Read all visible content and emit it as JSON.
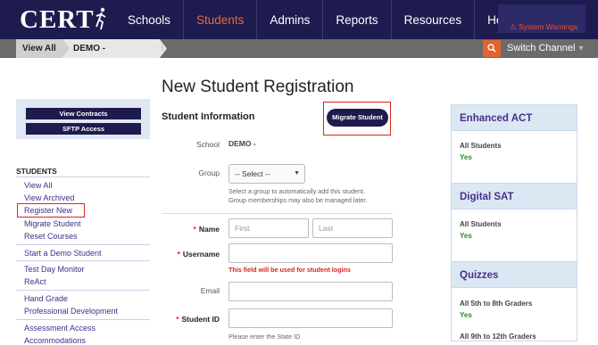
{
  "topbar": {
    "logo": "CERT",
    "nav": [
      {
        "label": "Schools",
        "active": false
      },
      {
        "label": "Students",
        "active": true
      },
      {
        "label": "Admins",
        "active": false
      },
      {
        "label": "Reports",
        "active": false
      },
      {
        "label": "Resources",
        "active": false
      },
      {
        "label": "Help",
        "active": false
      }
    ],
    "system_warnings": "System Warnings",
    "colors": {
      "bar": "#1e1b4f",
      "active": "#e66a3e",
      "warning": "#e55230"
    }
  },
  "subbar": {
    "breadcrumb": [
      "View All",
      "DEMO -"
    ],
    "breadcrumb_sep": "⁝",
    "switch_channel": "Switch Channel",
    "search_icon": "search-icon"
  },
  "page": {
    "title": "New Student Registration"
  },
  "sidebar": {
    "buttons": [
      "View Contracts",
      "SFTP Access"
    ],
    "heading": "STUDENTS",
    "groups": [
      [
        "View All",
        "View Archived",
        "Register New",
        "Migrate Student",
        "Reset Courses"
      ],
      [
        "Start a Demo Student"
      ],
      [
        "Test Day Monitor",
        "ReAct"
      ],
      [
        "Hand Grade",
        "Professional Development"
      ],
      [
        "Assessment Access",
        "Accommodations"
      ]
    ]
  },
  "form": {
    "section_title": "Student Information",
    "migrate_button": "Migrate Student",
    "school_label": "School",
    "school_value": "DEMO -",
    "group_label": "Group",
    "group_selected": "-- Select --",
    "group_help_1": "Select a group to automatically add this student.",
    "group_help_2": "Group memberships may also be managed later.",
    "name_label": "Name",
    "first_placeholder": "First",
    "last_placeholder": "Last",
    "username_label": "Username",
    "username_note": "This field will be used for student logins",
    "email_label": "Email",
    "student_id_label": "Student ID",
    "student_id_note": "Please enter the State ID",
    "required_mark": "*"
  },
  "right_panels": [
    {
      "title": "Enhanced ACT",
      "items": [
        {
          "label": "All Students",
          "value": "Yes"
        }
      ]
    },
    {
      "title": "Digital SAT",
      "items": [
        {
          "label": "All Students",
          "value": "Yes"
        }
      ]
    },
    {
      "title": "Quizzes",
      "items": [
        {
          "label": "All 5th to 8th Graders",
          "value": "Yes"
        },
        {
          "label": "All 9th to 12th Graders",
          "value": ""
        }
      ]
    }
  ]
}
